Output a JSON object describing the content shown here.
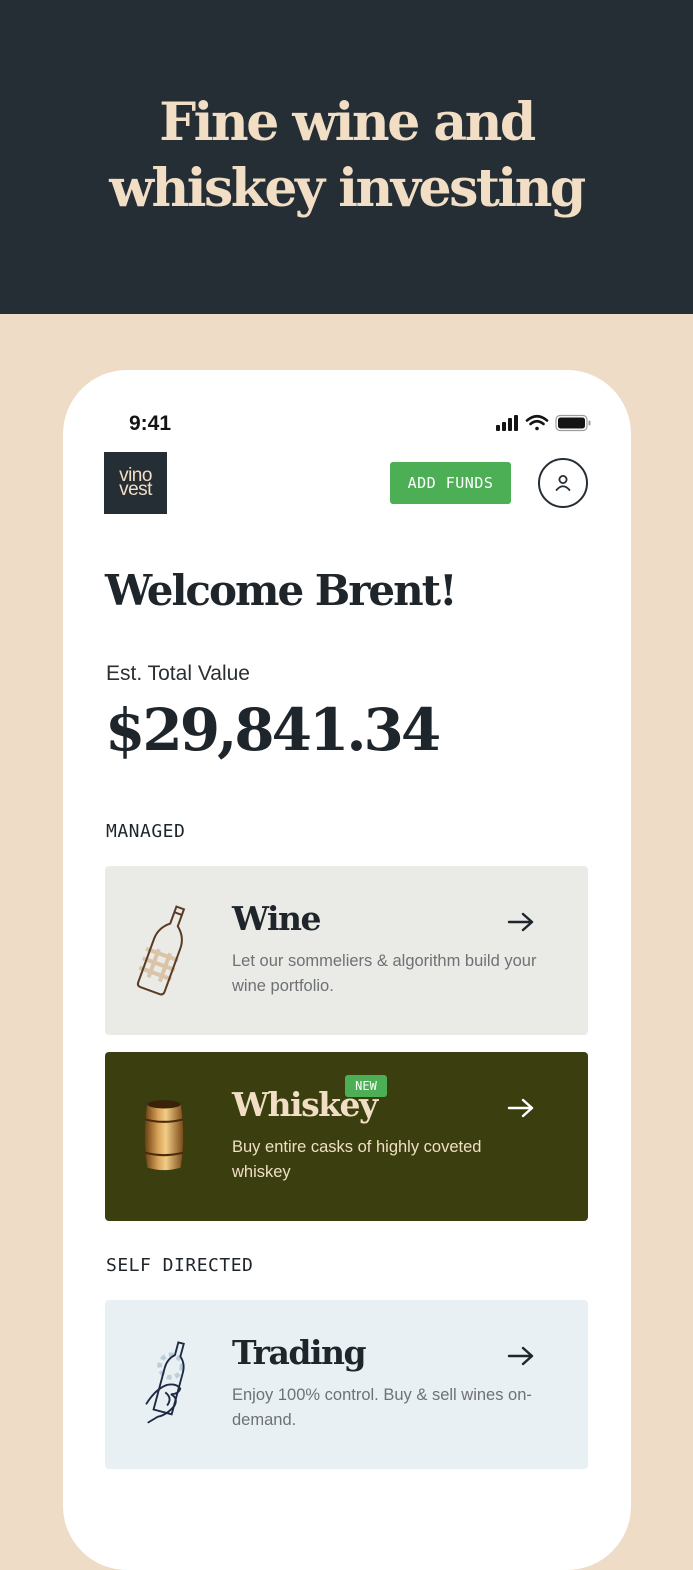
{
  "hero": {
    "line1": "Fine wine and",
    "line2": "whiskey investing"
  },
  "status_bar": {
    "time": "9:41"
  },
  "header": {
    "logo_line1": "vino",
    "logo_line2": "vest",
    "add_funds_label": "ADD FUNDS"
  },
  "welcome": "Welcome Brent!",
  "portfolio": {
    "label": "Est. Total Value",
    "value": "$29,841.34"
  },
  "sections": {
    "managed": "MANAGED",
    "self_directed": "SELF DIRECTED"
  },
  "cards": {
    "wine": {
      "title": "Wine",
      "description": "Let our sommeliers & algorithm build your wine portfolio."
    },
    "whiskey": {
      "title": "Whiskey",
      "badge": "NEW",
      "description": "Buy entire casks of highly coveted whiskey"
    },
    "trading": {
      "title": "Trading",
      "description": "Enjoy 100% control. Buy & sell wines on-demand."
    }
  },
  "colors": {
    "hero_bg": "#262E35",
    "hero_text": "#F1DEC4",
    "page_bg": "#EEDCC7",
    "accent_green": "#4CAF55",
    "wine_card_bg": "#EAEAE6",
    "whiskey_card_bg": "#3B3F10",
    "trading_card_bg": "#E9F0F3"
  },
  "icons": {
    "wine": "wine-bottle-icon",
    "whiskey": "barrel-icon",
    "trading": "hand-bottle-icon",
    "arrow": "arrow-right-icon",
    "profile": "user-icon"
  }
}
